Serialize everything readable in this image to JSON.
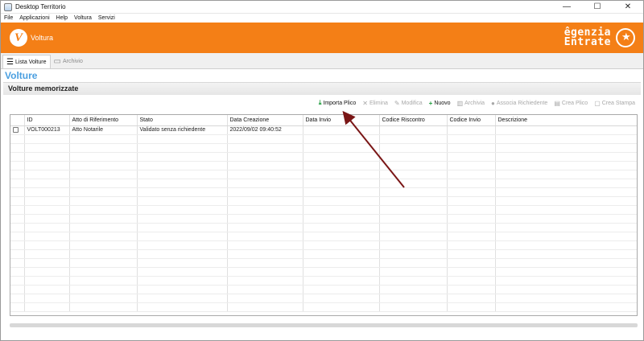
{
  "window": {
    "title": "Desktop Territorio",
    "controls": [
      "—",
      "☐",
      "✕"
    ]
  },
  "menubar": [
    "File",
    "Applicazioni",
    "Help",
    "Voltura",
    "Servizi"
  ],
  "header": {
    "logo_letter": "V",
    "app_name": "Voltura",
    "brand_line1": "genzia",
    "brand_line2": "ntrate",
    "brand_initial1": "ê",
    "brand_initial2": "E",
    "brand_color": "#f47f16"
  },
  "tabs": [
    {
      "label": "Lista Volture",
      "icon": "list-icon"
    },
    {
      "label": "Archivio",
      "icon": "archive-icon"
    }
  ],
  "page": {
    "section_title": "Volture",
    "subheader": "Volture memorizzate"
  },
  "toolbar": [
    {
      "label": "Importa Plico",
      "icon": "download-icon",
      "glyph": "⤓",
      "enabled": true
    },
    {
      "label": "Elimina",
      "icon": "delete-icon",
      "glyph": "✕",
      "enabled": false
    },
    {
      "label": "Modifica",
      "icon": "pencil-icon",
      "glyph": "✎",
      "enabled": false
    },
    {
      "label": "Nuovo",
      "icon": "plus-icon",
      "glyph": "+",
      "enabled": true
    },
    {
      "label": "Archivia",
      "icon": "archive-box-icon",
      "glyph": "▥",
      "enabled": false
    },
    {
      "label": "Associa Richiedente",
      "icon": "user-icon",
      "glyph": "●",
      "enabled": false
    },
    {
      "label": "Crea Plico",
      "icon": "package-icon",
      "glyph": "▤",
      "enabled": false
    },
    {
      "label": "Crea Stampa",
      "icon": "print-icon",
      "glyph": "▢",
      "enabled": false
    }
  ],
  "table": {
    "columns": [
      "",
      "ID",
      "Atto di Riferimento",
      "Stato",
      "Data Creazione",
      "Data Invio",
      "Codice Riscontro",
      "Codice Invio",
      "Descrizione"
    ],
    "rows": [
      [
        "",
        "VOLT000213",
        "Atto Notarile",
        "Validato senza richiedente",
        "2022/09/02 09:40:52",
        "",
        "",
        "",
        ""
      ]
    ],
    "empty_rows": 20
  },
  "annotation": {
    "color": "#7a1616"
  }
}
